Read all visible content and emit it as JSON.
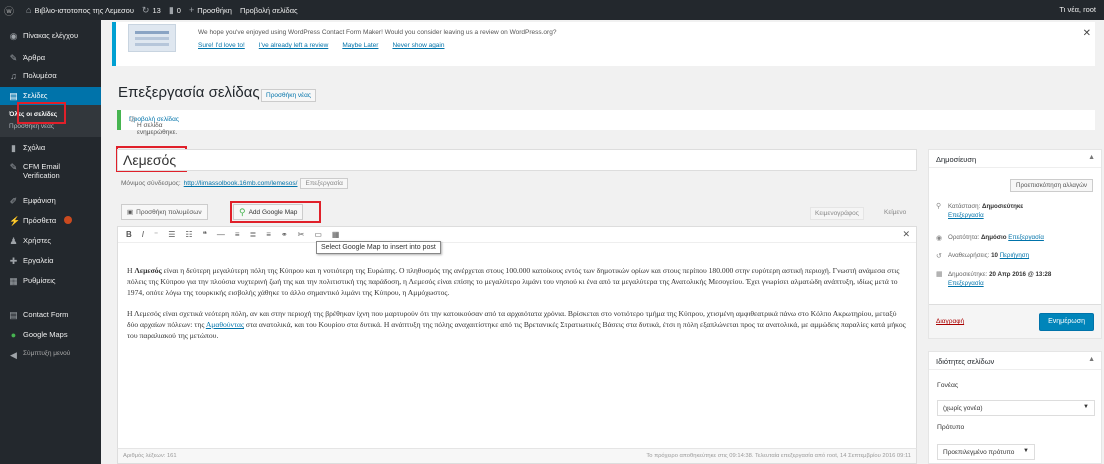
{
  "adminbar": {
    "site_name": "Βιβλιο-ιστοτοπος της Λεμεσου",
    "updates_count": "13",
    "comments_count": "0",
    "new_label": "Προσθήκη",
    "view_label": "Προβολή σελίδας",
    "greeting": "Τι νέα, root"
  },
  "sidebar": {
    "items": [
      {
        "label": "Πίνακας ελέγχου",
        "icon": "dashboard-icon"
      },
      {
        "label": "Άρθρα",
        "icon": "pin-icon"
      },
      {
        "label": "Πολυμέσα",
        "icon": "media-icon"
      },
      {
        "label": "Σελίδες",
        "icon": "pages-icon"
      },
      {
        "label": "Σχόλια",
        "icon": "comments-icon"
      },
      {
        "label": "CFM Email Verification",
        "icon": "pin-icon"
      },
      {
        "label": "Εμφάνιση",
        "icon": "appearance-icon"
      },
      {
        "label": "Πρόσθετα",
        "icon": "plugins-icon"
      },
      {
        "label": "Χρήστες",
        "icon": "users-icon"
      },
      {
        "label": "Εργαλεία",
        "icon": "tools-icon"
      },
      {
        "label": "Ρυθμίσεις",
        "icon": "settings-icon"
      },
      {
        "label": "Contact Form",
        "icon": "form-icon"
      },
      {
        "label": "Google Maps",
        "icon": "map-icon"
      },
      {
        "label": "Σύμπτυξη μενού",
        "icon": "collapse-icon"
      }
    ],
    "submenu": {
      "all_pages": "Όλες οι σελίδες",
      "add_new": "Προσθήκη νέας"
    }
  },
  "notice": {
    "message": "We hope you've enjoyed using WordPress Contact Form Maker! Would you consider leaving us a review on WordPress.org?",
    "links": [
      "Sure! I'd love to!",
      "I've already left a review",
      "Maybe Later",
      "Never show again"
    ]
  },
  "header": {
    "title": "Επεξεργασία σελίδας",
    "add_new": "Προσθήκη νέας"
  },
  "updated_notice": {
    "text": "Η σελίδα ενημερώθηκε.",
    "link": "Προβολή σελίδας"
  },
  "editor": {
    "title_value": "Λεμεσός",
    "permalink_label": "Μόνιμος σύνδεσμος:",
    "permalink_url": "http://limassolbook.16mb.com/lemesos/",
    "permalink_edit": "Επεξεργασία",
    "add_media": "Προσθήκη πολυμέσων",
    "add_map": "Add Google Map",
    "tab_visual": "Κειμενογράφος",
    "tab_text": "Κείμενο",
    "tooltip": "Select Google Map to insert into post",
    "para1_bold": "Λεμεσός",
    "para1_pre": "Η ",
    "para1": " είναι η δεύτερη μεγαλύτερη πόλη της Κύπρου και η νοτιότερη της Ευρώπης. Ο πληθυσμός της ανέρχεται στους 100.000 κατοίκους εντός των δημοτικών ορίων και στους περίπου 180.000 στην ευρύτερη αστική περιοχή. Γνωστή ανάμεσα στις πόλεις της Κύπρου για την πλούσια νυχτερινή ζωή της και την πολιτιστική της παράδοση, η Λεμεσός είναι επίσης το μεγαλύτερο λιμάνι του νησιού κι ένα από τα μεγαλύτερα της Ανατολικής Μεσογείου. Έχει γνωρίσει αλματώδη ανάπτυξη, ιδίως μετά το 1974, οπότε λόγω της τουρκικής εισβολής χάθηκε το άλλο σημαντικό λιμάνι της Κύπρου, η Αμμόχωστος.",
    "para2_a": "Η Λεμεσός είναι σχετικά νεότερη πόλη, αν και στην περιοχή της βρέθηκαν ίχνη που μαρτυρούν ότι την κατοικούσαν από τα αρχαιότατα χρόνια. Βρίσκεται στο νοτιότερο τμήμα της Κύπρου, χτισμένη αμφιθεατρικά πάνω στο Κόλπο Ακρωτηρίου, μεταξύ δύο αρχαίων πόλεων: της ",
    "para2_link": "Αμαθούντας",
    "para2_b": " στα ανατολικά, και του Κουρίου στα δυτικά. Η ανάπτυξη της πόλης αναχαιτίστηκε από τις Βρετανικές Στρατιωτικές Βάσεις στα δυτικά, έτσι η πόλη εξαπλώνεται προς τα ανατολικά, με αμμώδεις παραλίες κατά μήκος του παραλιακού της μετώπου.",
    "word_count": "Αριθμός λέξεων: 161",
    "last_saved": "Το πρόχειρο αποθηκεύτηκε στις 09:14:38. Τελευταία επεξεργασία από root, 14 Σεπτεμβρίου 2016 09:11"
  },
  "publish": {
    "title": "Δημοσίευση",
    "preview": "Προεπισκόπηση αλλαγών",
    "status_label": "Κατάσταση:",
    "status_value": "Δημοσιεύτηκε",
    "status_edit": "Επεξεργασία",
    "visibility_label": "Ορατότητα:",
    "visibility_value": "Δημόσιο",
    "visibility_edit": "Επεξεργασία",
    "revisions_label": "Αναθεωρήσεις:",
    "revisions_value": "10",
    "revisions_link": "Περιήγηση",
    "published_label": "Δημοσιεύτηκε:",
    "published_value": "20 Απρ 2016 @ 13:28",
    "published_edit": "Επεξεργασία",
    "trash": "Διαγραφή",
    "update": "Ενημέρωση"
  },
  "attributes": {
    "title": "Ιδιότητες σελίδων",
    "parent_label": "Γονέας",
    "parent_value": "(χωρίς γονέα)",
    "template_label": "Πρότυπο",
    "template_value": "Προεπιλεγμένο πρότυπο"
  },
  "colors": {
    "accent": "#0073aa",
    "highlight_box": "#e0202a",
    "sidebar": "#23282d"
  }
}
